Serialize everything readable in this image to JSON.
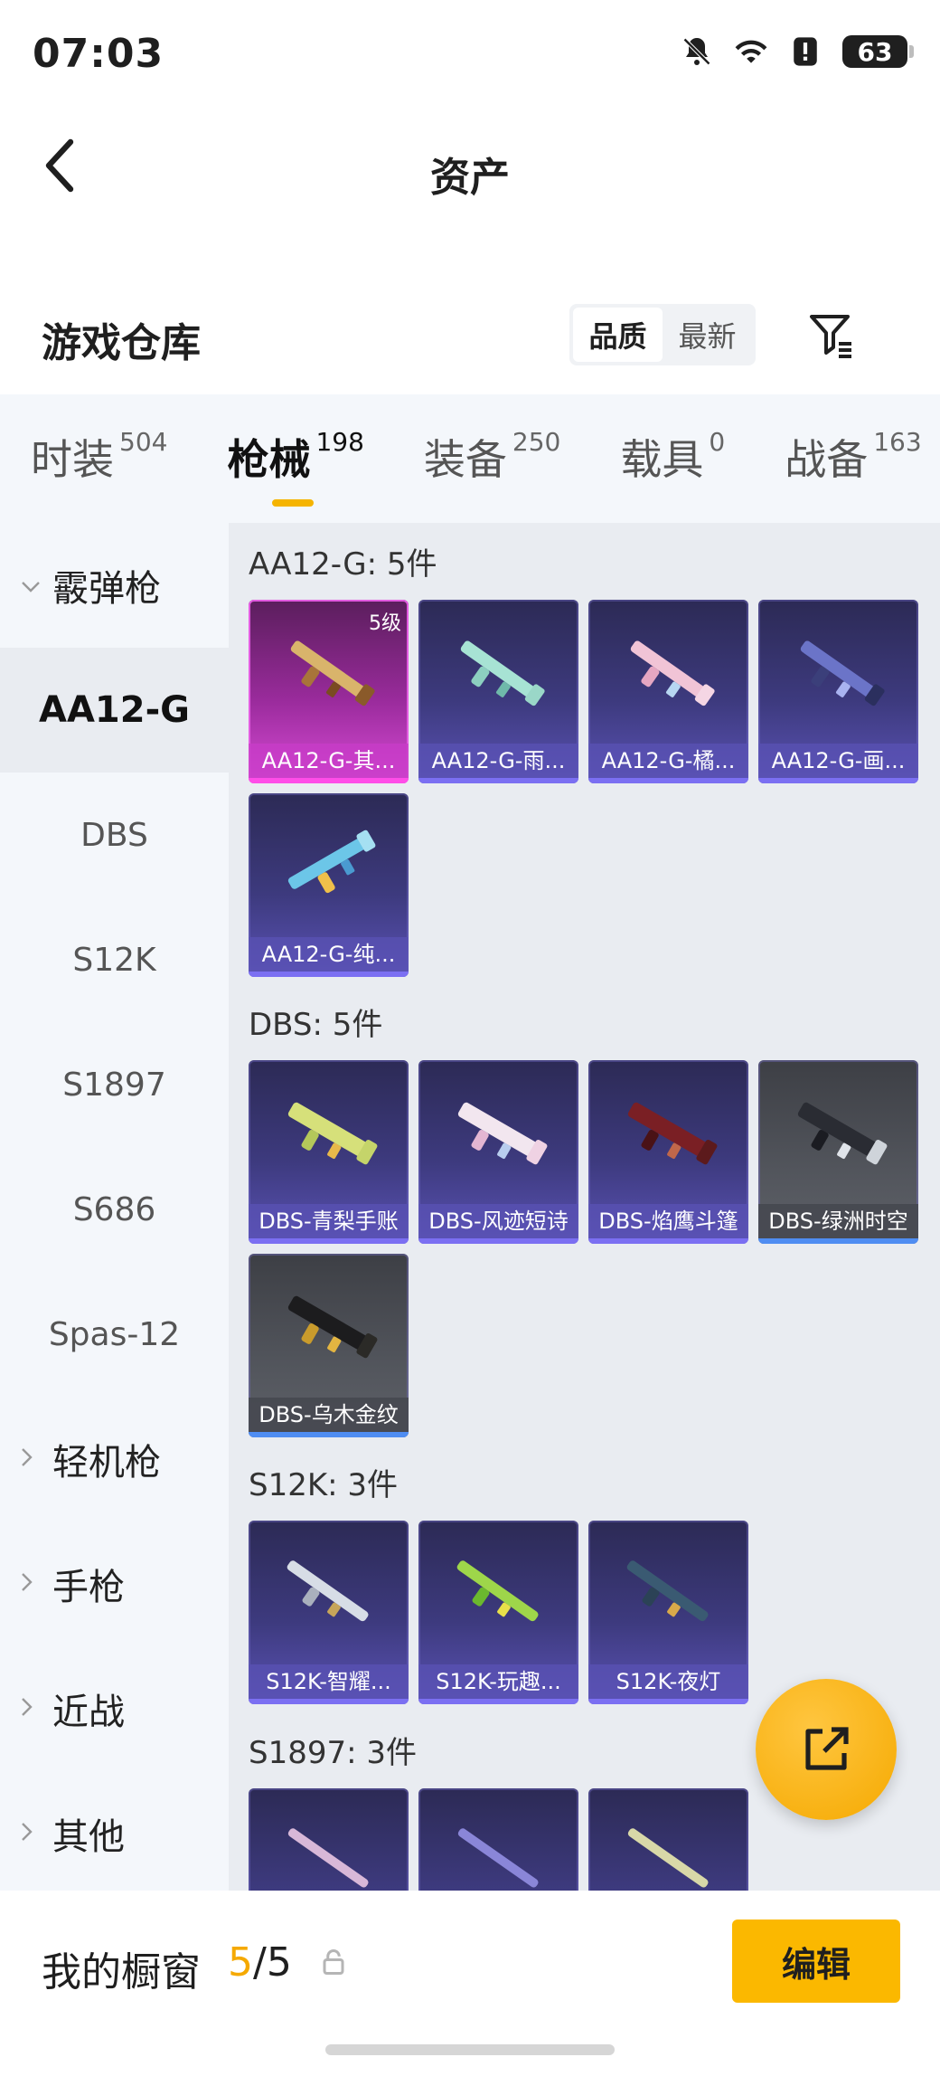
{
  "status_bar": {
    "time": "07:03",
    "battery": "63"
  },
  "header": {
    "title": "资产"
  },
  "warehouse": {
    "title": "游戏仓库",
    "sort_options": [
      "品质",
      "最新"
    ],
    "sort_selected": "品质"
  },
  "tabs": [
    {
      "label": "时装",
      "count": "504"
    },
    {
      "label": "枪械",
      "count": "198",
      "active": true
    },
    {
      "label": "装备",
      "count": "250"
    },
    {
      "label": "载具",
      "count": "0"
    },
    {
      "label": "战备",
      "count": "163"
    }
  ],
  "sidebar": {
    "items": [
      {
        "label": "霰弹枪",
        "type": "category",
        "expanded": true
      },
      {
        "label": "AA12-G",
        "type": "sub",
        "active": true
      },
      {
        "label": "DBS",
        "type": "sub"
      },
      {
        "label": "S12K",
        "type": "sub"
      },
      {
        "label": "S1897",
        "type": "sub"
      },
      {
        "label": "S686",
        "type": "sub"
      },
      {
        "label": "Spas-12",
        "type": "sub"
      },
      {
        "label": "轻机枪",
        "type": "category"
      },
      {
        "label": "手枪",
        "type": "category"
      },
      {
        "label": "近战",
        "type": "category"
      },
      {
        "label": "其他",
        "type": "category"
      }
    ]
  },
  "groups": [
    {
      "title": "AA12-G: 5件",
      "items": [
        {
          "name": "AA12-G-其...",
          "level": "5级",
          "rarity": "pink"
        },
        {
          "name": "AA12-G-雨...",
          "rarity": "purple"
        },
        {
          "name": "AA12-G-橘...",
          "rarity": "purple"
        },
        {
          "name": "AA12-G-画...",
          "rarity": "purple"
        },
        {
          "name": "AA12-G-纯...",
          "rarity": "purple"
        }
      ]
    },
    {
      "title": "DBS: 5件",
      "items": [
        {
          "name": "DBS-青梨手账",
          "rarity": "purple"
        },
        {
          "name": "DBS-风迹短诗",
          "rarity": "purple"
        },
        {
          "name": "DBS-焰鹰斗篷",
          "rarity": "purple"
        },
        {
          "name": "DBS-绿洲时空",
          "rarity": "grey"
        },
        {
          "name": "DBS-乌木金纹",
          "rarity": "grey"
        }
      ]
    },
    {
      "title": "S12K: 3件",
      "items": [
        {
          "name": "S12K-智耀...",
          "rarity": "purple"
        },
        {
          "name": "S12K-玩趣...",
          "rarity": "purple"
        },
        {
          "name": "S12K-夜灯",
          "rarity": "purple"
        }
      ]
    },
    {
      "title": "S1897: 3件",
      "items": [
        {
          "name": "",
          "rarity": "purple"
        },
        {
          "name": "",
          "rarity": "purple"
        },
        {
          "name": "",
          "rarity": "purple"
        }
      ]
    }
  ],
  "bottom_bar": {
    "showcase_label": "我的橱窗",
    "showcase_current": "5",
    "showcase_separator": "/",
    "showcase_total": "5",
    "edit_label": "编辑"
  },
  "colors": {
    "accent": "#f5b400",
    "pink_rarity": "#d74bd5",
    "purple_rarity": "#5a52b4",
    "grey_rarity": "#52555c"
  }
}
